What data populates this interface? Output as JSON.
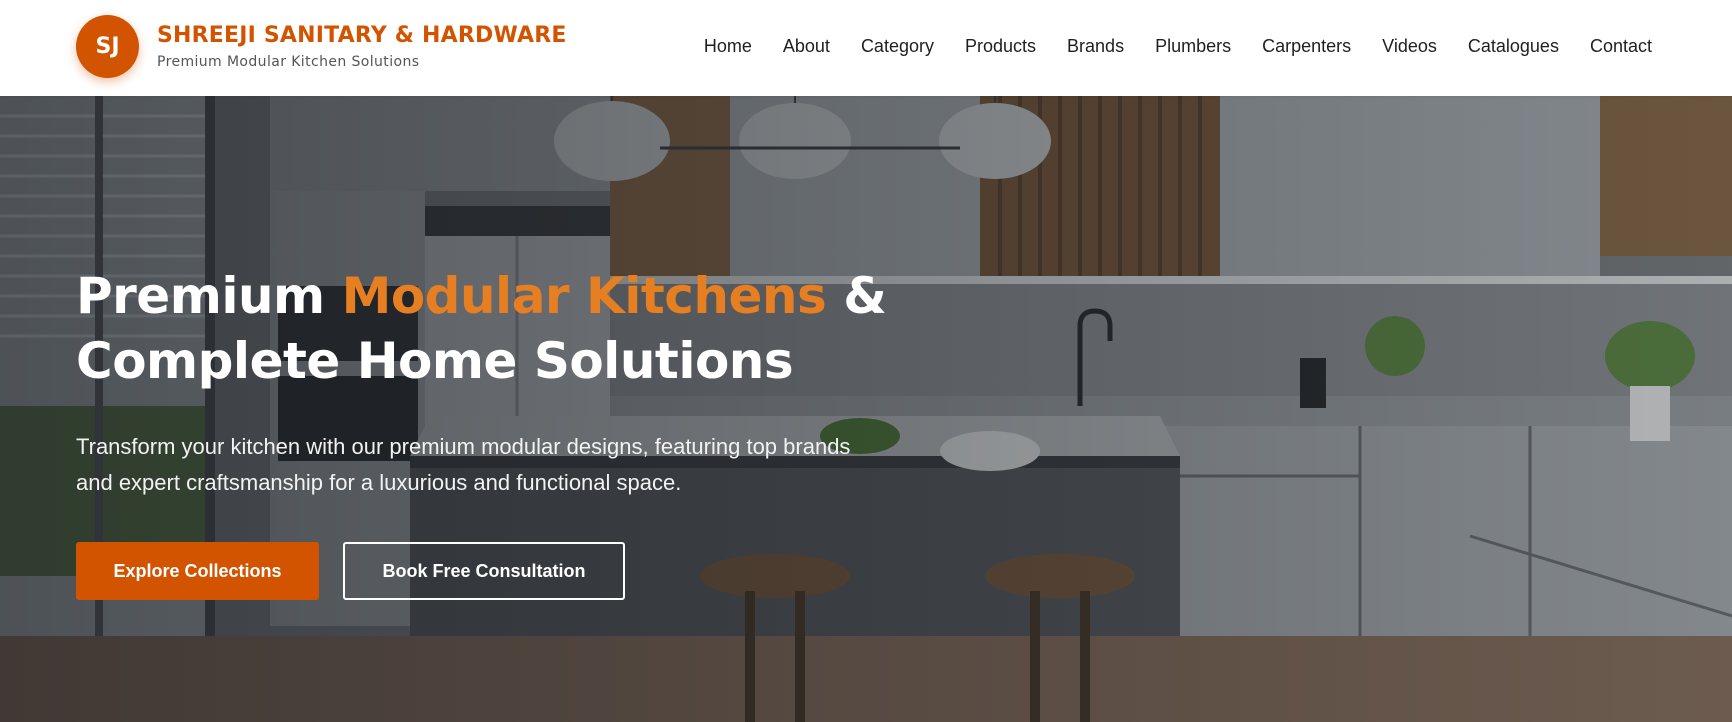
{
  "brand": {
    "logo_initials": "SJ",
    "name": "SHREEJI SANITARY & HARDWARE",
    "tagline": "Premium Modular Kitchen Solutions"
  },
  "nav": {
    "items": [
      {
        "label": "Home"
      },
      {
        "label": "About"
      },
      {
        "label": "Category"
      },
      {
        "label": "Products"
      },
      {
        "label": "Brands"
      },
      {
        "label": "Plumbers"
      },
      {
        "label": "Carpenters"
      },
      {
        "label": "Videos"
      },
      {
        "label": "Catalogues"
      },
      {
        "label": "Contact"
      }
    ]
  },
  "hero": {
    "title_part1": "Premium ",
    "title_accent": "Modular Kitchens",
    "title_part2": " &",
    "title_line2": "Complete Home Solutions",
    "subtitle": "Transform your kitchen with our premium modular designs, featuring top brands and expert craftsmanship for a luxurious and functional space.",
    "primary_button": "Explore Collections",
    "secondary_button": "Book Free Consultation"
  },
  "colors": {
    "brand": "#d35400",
    "accent": "#e67e22",
    "nav_text": "#1f1f1f"
  }
}
